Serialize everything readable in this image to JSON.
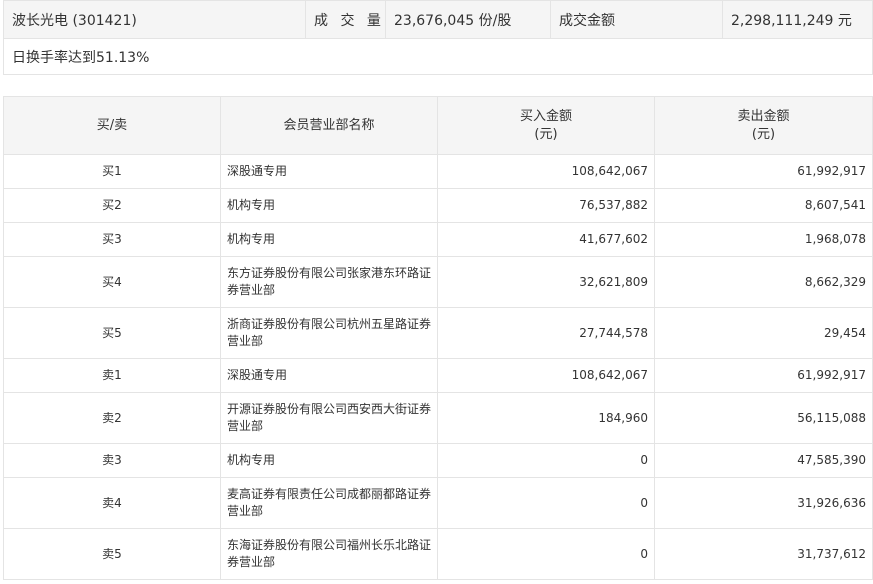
{
  "summary": {
    "stock_name": "波长光电 (301421)",
    "volume_label": "成 交 量",
    "volume_value": "23,676,045 份/股",
    "amount_label": "成交金额",
    "amount_value": "2,298,111,249 元",
    "turnover_note": "日换手率达到51.13%"
  },
  "table": {
    "headers": {
      "side": "买/卖",
      "branch": "会员营业部名称",
      "buy_line1": "买入金额",
      "buy_line2": "(元)",
      "sell_line1": "卖出金额",
      "sell_line2": "(元)"
    },
    "rows": [
      {
        "side": "买1",
        "branch": "深股通专用",
        "buy": "108,642,067",
        "sell": "61,992,917"
      },
      {
        "side": "买2",
        "branch": "机构专用",
        "buy": "76,537,882",
        "sell": "8,607,541"
      },
      {
        "side": "买3",
        "branch": "机构专用",
        "buy": "41,677,602",
        "sell": "1,968,078"
      },
      {
        "side": "买4",
        "branch": "东方证券股份有限公司张家港东环路证券营业部",
        "buy": "32,621,809",
        "sell": "8,662,329"
      },
      {
        "side": "买5",
        "branch": "浙商证券股份有限公司杭州五星路证券营业部",
        "buy": "27,744,578",
        "sell": "29,454"
      },
      {
        "side": "卖1",
        "branch": "深股通专用",
        "buy": "108,642,067",
        "sell": "61,992,917"
      },
      {
        "side": "卖2",
        "branch": "开源证券股份有限公司西安西大街证券营业部",
        "buy": "184,960",
        "sell": "56,115,088"
      },
      {
        "side": "卖3",
        "branch": "机构专用",
        "buy": "0",
        "sell": "47,585,390"
      },
      {
        "side": "卖4",
        "branch": "麦高证券有限责任公司成都丽都路证券营业部",
        "buy": "0",
        "sell": "31,926,636"
      },
      {
        "side": "卖5",
        "branch": "东海证券股份有限公司福州长乐北路证券营业部",
        "buy": "0",
        "sell": "31,737,612"
      }
    ]
  }
}
